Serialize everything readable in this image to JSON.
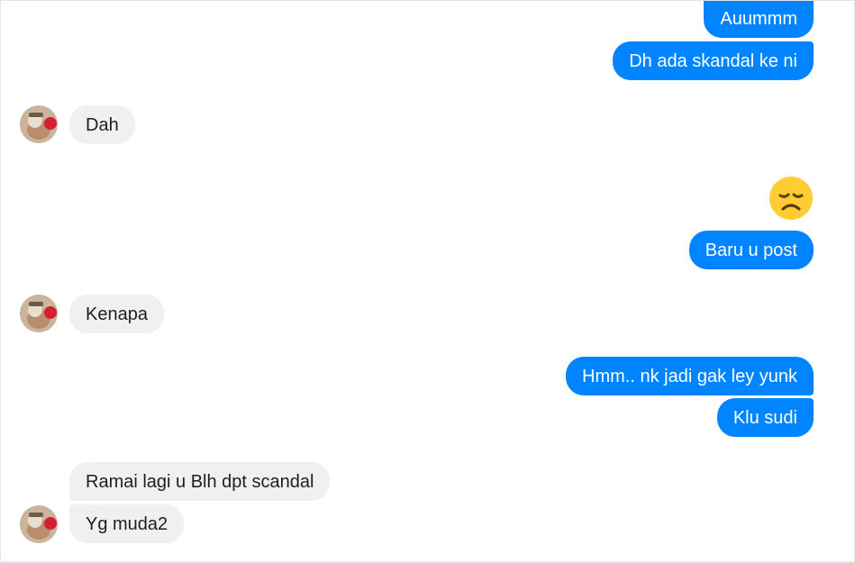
{
  "conversation": {
    "messages": [
      {
        "text": "Auummm",
        "from": "me"
      },
      {
        "text": "Dh ada skandal ke ni",
        "from": "me"
      },
      {
        "text": "Dah",
        "from": "them"
      },
      {
        "emoji": "disappointed-face",
        "from": "me"
      },
      {
        "text": "Baru u post",
        "from": "me"
      },
      {
        "text": "Kenapa",
        "from": "them"
      },
      {
        "text": "Hmm.. nk jadi gak ley yunk",
        "from": "me"
      },
      {
        "text": "Klu sudi",
        "from": "me"
      },
      {
        "text": "Ramai lagi u Blh dpt scandal",
        "from": "them"
      },
      {
        "text": "Yg muda2",
        "from": "them"
      }
    ]
  },
  "colors": {
    "outgoing_bubble": "#0084ff",
    "incoming_bubble": "#f1f0f0",
    "outgoing_text": "#ffffff",
    "incoming_text": "#1c1e21"
  },
  "icons": {
    "avatar": "user-avatar",
    "emoji": "disappointed-face-emoji"
  }
}
